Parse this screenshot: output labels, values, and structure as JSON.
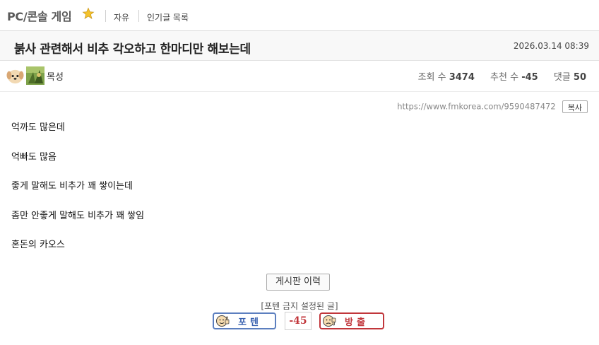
{
  "header": {
    "board_title": "PC/콘솔 게임",
    "crumbs": [
      "자유",
      "인기글 목록"
    ]
  },
  "post": {
    "title": "붉사 관련해서 비추 각오하고 한마디만 해보는데",
    "date": "2026.03.14 08:39",
    "author": "목성",
    "stats": {
      "views_label": "조회 수",
      "views": "3474",
      "recommend_label": "추천 수",
      "recommend": "-45",
      "comments_label": "댓글",
      "comments": "50"
    },
    "url": "https://www.fmkorea.com/9590487472",
    "copy_label": "복사",
    "body": [
      "억까도 많은데",
      "억빠도 많음",
      "좋게 말해도 비추가 꽤 쌓이는데",
      "좀만 안좋게 말해도 비추가 꽤 쌓임",
      "혼돈의 카오스"
    ]
  },
  "footer": {
    "history_button": "게시판 이력",
    "vote_note": "[포텐 금지 설정된 글]",
    "potent_label": "포텐",
    "vote_count": "-45",
    "bangchul_label": "방출"
  },
  "colors": {
    "star": "#f4c22b",
    "potent": "#3a62b0",
    "bangchul": "#c1363b"
  },
  "icons": {
    "star": "star-icon",
    "avatar_dog": "puppy-avatar-icon",
    "avatar_leaf": "nature-avatar-icon",
    "potent_face": "thumbs-up-face-icon",
    "bangchul_face": "thumbs-down-face-icon"
  }
}
